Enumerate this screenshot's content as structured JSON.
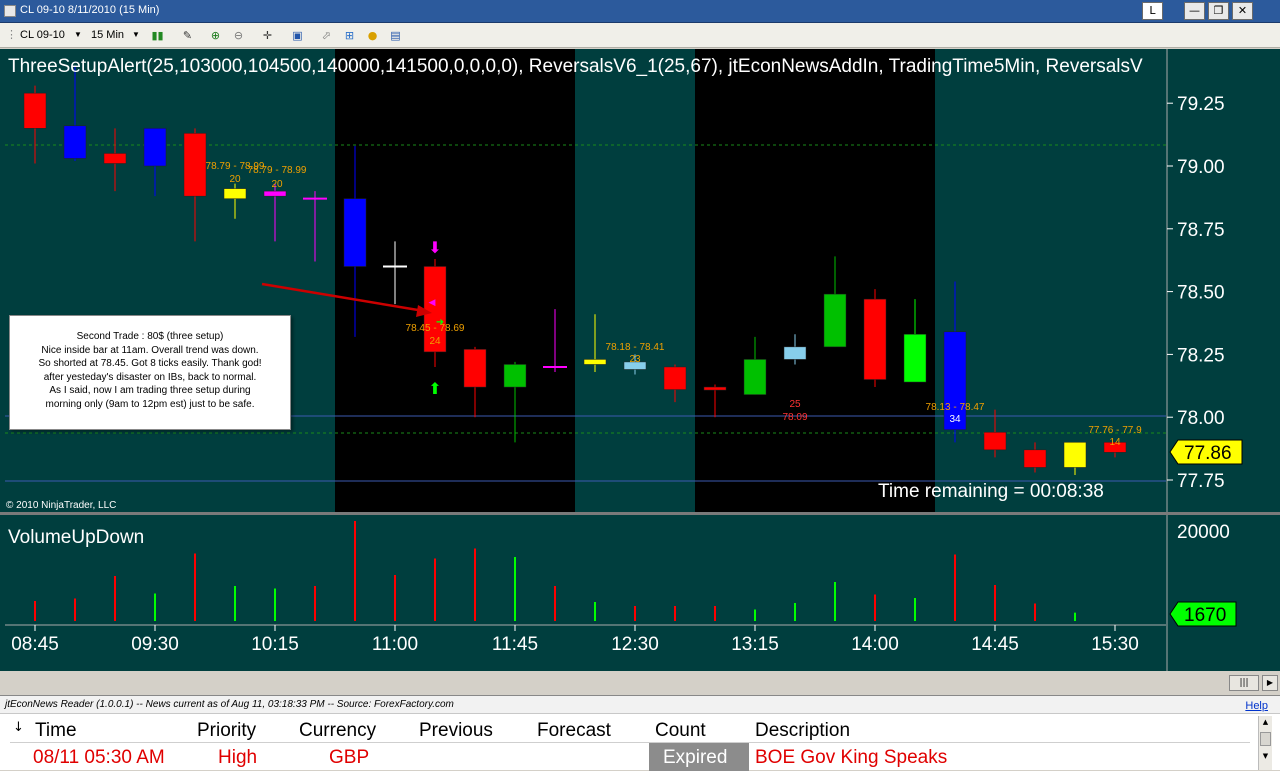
{
  "window": {
    "title": "CL 09-10  8/11/2010 (15 Min)",
    "buttons": {
      "link": "L",
      "minimize": "—",
      "restore": "❐",
      "close": "✕"
    }
  },
  "toolbar": {
    "instrument": "CL 09-10",
    "interval": "15 Min",
    "icons": [
      "bar-style-icon",
      "draw-pencil-icon",
      "zoom-in-icon",
      "zoom-out-icon",
      "crosshair-icon",
      "snapshot-icon",
      "chart-trader-icon",
      "strategies-icon",
      "indicators-icon",
      "data-box-icon"
    ]
  },
  "chart": {
    "indicator_header": "ThreeSetupAlert(25,103000,104500,140000,141500,0,0,0,0),  ReversalsV6_1(25,67),  jtEconNewsAddIn,  TradingTime5Min,  ReversalsV",
    "copyright": "© 2010 NinjaTrader, LLC",
    "time_remaining": "Time remaining = 00:08:38",
    "last_price": "77.86",
    "volume_panel_title": "VolumeUpDown",
    "volume_axis_label": "20000",
    "last_volume": "1670",
    "price_annotations": [
      {
        "text": "78.79 - 78.99",
        "bar": 5,
        "color": "#f0a000"
      },
      {
        "text": "20",
        "bar": 5,
        "color": "#f0a000"
      },
      {
        "text": "78.79 - 78.99",
        "bar": 6,
        "color": "#f0a000"
      },
      {
        "text": "20",
        "bar": 6,
        "color": "#f0a000"
      },
      {
        "text": "78.45 - 78.69",
        "bar": 10,
        "color": "#f0a000"
      },
      {
        "text": "24",
        "bar": 10,
        "color": "#f0a000"
      },
      {
        "text": "78.18 - 78.41",
        "bar": 15,
        "color": "#f0a000"
      },
      {
        "text": "23",
        "bar": 15,
        "color": "#f0a000"
      },
      {
        "text": "25",
        "bar": 19,
        "color": "#ff3333"
      },
      {
        "text": "78.09",
        "bar": 19,
        "color": "#ff3333"
      },
      {
        "text": "78.13 - 78.47",
        "bar": 23,
        "color": "#f0a000"
      },
      {
        "text": "34",
        "bar": 23,
        "color": "#ffffff"
      },
      {
        "text": "77.76 - 77.9",
        "bar": 27,
        "color": "#f0a000"
      },
      {
        "text": "14",
        "bar": 27,
        "color": "#f0a000"
      }
    ],
    "note_lines": [
      "Second Trade : 80$ (three setup)",
      "Nice inside bar at 11am. Overall trend was down.",
      "So shorted at 78.45. Got 8 ticks easily. Thank god!",
      "after yesteday's disaster on IBs, back to normal.",
      "As I said, now I am trading three setup during",
      "morning only (9am to 12pm est) just to be safe."
    ],
    "colors": {
      "background": "#003e3e",
      "session_shade": "#000000",
      "up_green": "#00c000",
      "down_red": "#ff0000",
      "strong_up": "#00ff00",
      "blue": "#0000ff",
      "yellow": "#ffff00",
      "magenta": "#ff00ff",
      "light_blue": "#87ceeb",
      "last_price_tag": "#ffff00",
      "last_volume_tag": "#00ff00"
    }
  },
  "chart_data": {
    "type": "candlestick",
    "title": "",
    "xlabel": "",
    "ylabel": "",
    "y_ticks": [
      "79.25",
      "79.00",
      "78.75",
      "78.50",
      "78.25",
      "78.00",
      "77.75"
    ],
    "ylim": [
      77.6,
      79.45
    ],
    "x_ticks": [
      {
        "label": "08:45",
        "bar": 0
      },
      {
        "label": "09:30",
        "bar": 3
      },
      {
        "label": "10:15",
        "bar": 6
      },
      {
        "label": "11:00",
        "bar": 9
      },
      {
        "label": "11:45",
        "bar": 12
      },
      {
        "label": "12:30",
        "bar": 15
      },
      {
        "label": "13:15",
        "bar": 18
      },
      {
        "label": "14:00",
        "bar": 21
      },
      {
        "label": "14:45",
        "bar": 24
      },
      {
        "label": "15:30",
        "bar": 27
      }
    ],
    "session_shading_bars": [
      [
        8.2,
        14.2
      ],
      [
        17.2,
        23.2
      ]
    ],
    "bars": [
      {
        "open": 79.15,
        "high": 79.32,
        "low": 79.01,
        "close": 79.29,
        "color": "#ff0000"
      },
      {
        "open": 79.03,
        "high": 79.4,
        "low": 79.02,
        "close": 79.16,
        "color": "#0000ff"
      },
      {
        "open": 79.05,
        "high": 79.15,
        "low": 78.9,
        "close": 79.01,
        "color": "#ff0000"
      },
      {
        "open": 79.0,
        "high": 79.15,
        "low": 78.88,
        "close": 79.15,
        "color": "#0000ff"
      },
      {
        "open": 79.13,
        "high": 79.15,
        "low": 78.7,
        "close": 78.88,
        "color": "#ff0000"
      },
      {
        "open": 78.87,
        "high": 78.93,
        "low": 78.79,
        "close": 78.91,
        "color": "#ffff00"
      },
      {
        "open": 78.88,
        "high": 78.93,
        "low": 78.7,
        "close": 78.9,
        "color": "#ff00ff"
      },
      {
        "open": 78.86,
        "high": 78.9,
        "low": 78.62,
        "close": 78.87,
        "color": "#ff00ff"
      },
      {
        "open": 78.6,
        "high": 79.08,
        "low": 78.32,
        "close": 78.87,
        "color": "#0000ff"
      },
      {
        "open": 78.6,
        "high": 78.7,
        "low": 78.45,
        "close": 78.6,
        "color": "#ffffff"
      },
      {
        "open": 78.6,
        "high": 78.63,
        "low": 78.2,
        "close": 78.26,
        "color": "#ff0000"
      },
      {
        "open": 78.27,
        "high": 78.28,
        "low": 78.0,
        "close": 78.12,
        "color": "#ff0000"
      },
      {
        "open": 78.12,
        "high": 78.22,
        "low": 77.9,
        "close": 78.21,
        "color": "#00c000"
      },
      {
        "open": 78.2,
        "high": 78.43,
        "low": 78.18,
        "close": 78.2,
        "color": "#ff00ff"
      },
      {
        "open": 78.21,
        "high": 78.41,
        "low": 78.18,
        "close": 78.23,
        "color": "#ffff00"
      },
      {
        "open": 78.19,
        "high": 78.25,
        "low": 78.17,
        "close": 78.22,
        "color": "#87ceeb"
      },
      {
        "open": 78.2,
        "high": 78.21,
        "low": 78.06,
        "close": 78.11,
        "color": "#ff0000"
      },
      {
        "open": 78.12,
        "high": 78.13,
        "low": 78.0,
        "close": 78.11,
        "color": "#ff0000"
      },
      {
        "open": 78.09,
        "high": 78.32,
        "low": 78.09,
        "close": 78.23,
        "color": "#00c000"
      },
      {
        "open": 78.23,
        "high": 78.33,
        "low": 78.21,
        "close": 78.28,
        "color": "#87ceeb"
      },
      {
        "open": 78.28,
        "high": 78.64,
        "low": 78.28,
        "close": 78.49,
        "color": "#00c000"
      },
      {
        "open": 78.47,
        "high": 78.51,
        "low": 78.12,
        "close": 78.15,
        "color": "#ff0000"
      },
      {
        "open": 78.14,
        "high": 78.47,
        "low": 78.14,
        "close": 78.33,
        "color": "#00ff00"
      },
      {
        "open": 78.34,
        "high": 78.54,
        "low": 77.9,
        "close": 77.95,
        "color": "#0000ff"
      },
      {
        "open": 77.94,
        "high": 78.03,
        "low": 77.84,
        "close": 77.87,
        "color": "#ff0000"
      },
      {
        "open": 77.87,
        "high": 77.9,
        "low": 77.78,
        "close": 77.8,
        "color": "#ff0000"
      },
      {
        "open": 77.8,
        "high": 77.9,
        "low": 77.77,
        "close": 77.9,
        "color": "#ffff00"
      },
      {
        "open": 77.9,
        "high": 77.9,
        "low": 77.84,
        "close": 77.86,
        "color": "#ff0000"
      }
    ],
    "volume": {
      "ylim": [
        0,
        20000
      ],
      "values": [
        4000,
        4500,
        9000,
        5500,
        13500,
        7000,
        6500,
        7000,
        20000,
        9200,
        12500,
        14500,
        12800,
        7000,
        3800,
        3000,
        3000,
        3000,
        2300,
        3600,
        7800,
        5300,
        4600,
        13300,
        7200,
        3500,
        1670,
        0
      ],
      "colors": [
        "#ff0000",
        "#ff0000",
        "#ff0000",
        "#00ff00",
        "#ff0000",
        "#00ff00",
        "#00ff00",
        "#ff0000",
        "#ff0000",
        "#ff0000",
        "#ff0000",
        "#ff0000",
        "#00ff00",
        "#ff0000",
        "#00ff00",
        "#ff0000",
        "#ff0000",
        "#ff0000",
        "#00ff00",
        "#00ff00",
        "#00ff00",
        "#ff0000",
        "#00ff00",
        "#ff0000",
        "#ff0000",
        "#ff0000",
        "#00ff00",
        "#00ff00"
      ]
    }
  },
  "news": {
    "header": "jtEconNews Reader (1.0.0.1)  --  News current as of Aug 11, 03:18:33 PM  --  Source: ForexFactory.com",
    "help": "Help",
    "columns": [
      "Time",
      "Priority",
      "Currency",
      "Previous",
      "Forecast",
      "Count",
      "Description"
    ],
    "row": {
      "time": "08/11 05:30 AM",
      "priority": "High",
      "currency": "GBP",
      "count": "Expired",
      "description": "BOE Gov King Speaks"
    }
  }
}
